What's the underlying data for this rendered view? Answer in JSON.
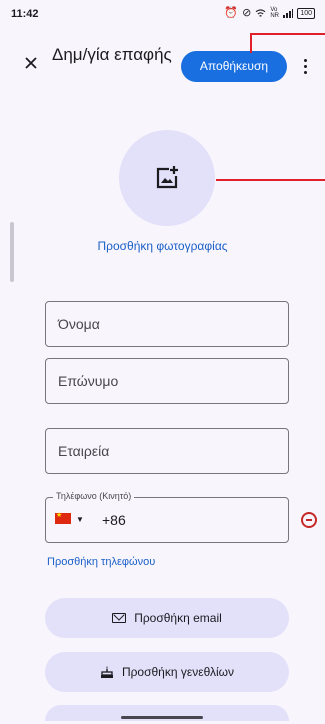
{
  "status_bar": {
    "time": "11:42",
    "battery": "100",
    "network": "Vo NR"
  },
  "header": {
    "title": "Δημ/γία επαφής",
    "save_label": "Αποθήκευση"
  },
  "photo": {
    "add_label": "Προσθήκη φωτογραφίας"
  },
  "form": {
    "first_name_placeholder": "Όνομα",
    "last_name_placeholder": "Επώνυμο",
    "company_placeholder": "Εταιρεία",
    "phone_label": "Τηλέφωνο (Κινητό)",
    "phone_country_code": "+86"
  },
  "actions": {
    "add_phone": "Προσθήκη τηλεφώνου",
    "add_email": "Προσθήκη email",
    "add_birthday": "Προσθήκη γενεθλίων"
  },
  "colors": {
    "accent": "#1a6fe0",
    "pill_bg": "#e3e0fa",
    "link": "#1a5fc8",
    "remove": "#c62828",
    "annotation": "#e0202a"
  },
  "icons": [
    "close-icon",
    "more-vert-icon",
    "add-photo-icon",
    "flag-china-icon",
    "dropdown-caret-icon",
    "remove-circle-icon",
    "mail-icon",
    "cake-icon"
  ]
}
